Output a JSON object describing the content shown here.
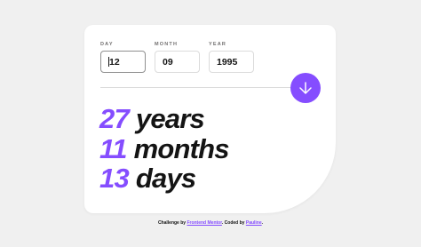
{
  "form": {
    "day": {
      "label": "DAY",
      "value": "12"
    },
    "month": {
      "label": "MONTH",
      "value": "09"
    },
    "year": {
      "label": "YEAR",
      "value": "1995"
    }
  },
  "submit": {
    "icon": "arrow-down-icon"
  },
  "results": {
    "years": {
      "value": "27",
      "unit": "years"
    },
    "months": {
      "value": "11",
      "unit": "months"
    },
    "days": {
      "value": "13",
      "unit": "days"
    }
  },
  "footer": {
    "prefix": "Challenge by ",
    "link1": "Frontend Mentor",
    "middle": ". Coded by ",
    "link2": "Pauline",
    "suffix": "."
  },
  "colors": {
    "accent": "#854dff",
    "text": "#141414",
    "label": "#716f6f",
    "background": "#f0f0f0"
  }
}
